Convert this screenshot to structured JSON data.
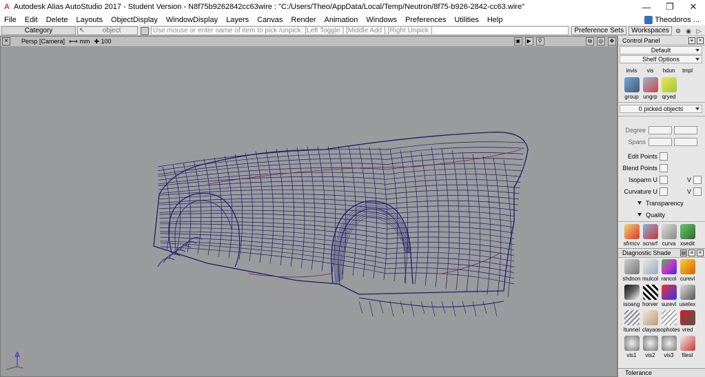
{
  "titlebar": {
    "title": "Autodesk Alias AutoStudio 2017  - Student Version   - N8f75b9262842cc63wire : \"C:/Users/Theo/AppData/Local/Temp/Neutron/8f75-b926-2842-cc63.wire\"",
    "minimize": "—",
    "restore": "❐",
    "close": "✕"
  },
  "menubar": {
    "items": [
      "File",
      "Edit",
      "Delete",
      "Layouts",
      "ObjectDisplay",
      "WindowDisplay",
      "Layers",
      "Canvas",
      "Render",
      "Animation",
      "Windows",
      "Preferences",
      "Utilities",
      "Help"
    ],
    "user": "Theodoros ..."
  },
  "promptbar": {
    "category": "Category",
    "object": "object",
    "message": "Use mouse or enter name of item to pick /unpick: [Left Toggle ] [Middle Add ] [Right Unpick ]",
    "preference_sets": "Preference Sets",
    "workspaces": "Workspaces"
  },
  "viewport": {
    "camera": "Persp [Camera]",
    "units": "mm",
    "grid": "100",
    "wire_color": "#1e1a6e",
    "bg_color": "#9a9b9c"
  },
  "control_panel": {
    "title": "Control Panel",
    "preset": "Default",
    "shelf_options": "Shelf Options",
    "shelf1": [
      "invis",
      "vis",
      "hdun",
      "tmpl"
    ],
    "shelf2": [
      "group",
      "ungrp",
      "qryed"
    ],
    "picked": "0 picked objects",
    "degree_label": "Degree",
    "spans_label": "Spans",
    "checks": [
      "Edit Points",
      "Blend Points",
      "Isoparm U",
      "Curvature U"
    ],
    "v_label": "V",
    "transparency": "Transparency",
    "quality": "Quality",
    "shelf3": [
      "sfrmcv",
      "scnsrf",
      "curva",
      "xsedit"
    ],
    "diagnostic_title": "Diagnostic Shade",
    "diag_row1": [
      "shdnon",
      "mulcol",
      "rancol",
      "curevl"
    ],
    "diag_row2": [
      "isoang",
      "horver",
      "surevl",
      "usetex"
    ],
    "diag_row3": [
      "ltunnel",
      "clayao",
      "sophotes",
      "vred"
    ],
    "diag_row4": [
      "vis1",
      "vis2",
      "vis3",
      "filest"
    ],
    "tolerance": "Tolerance"
  }
}
